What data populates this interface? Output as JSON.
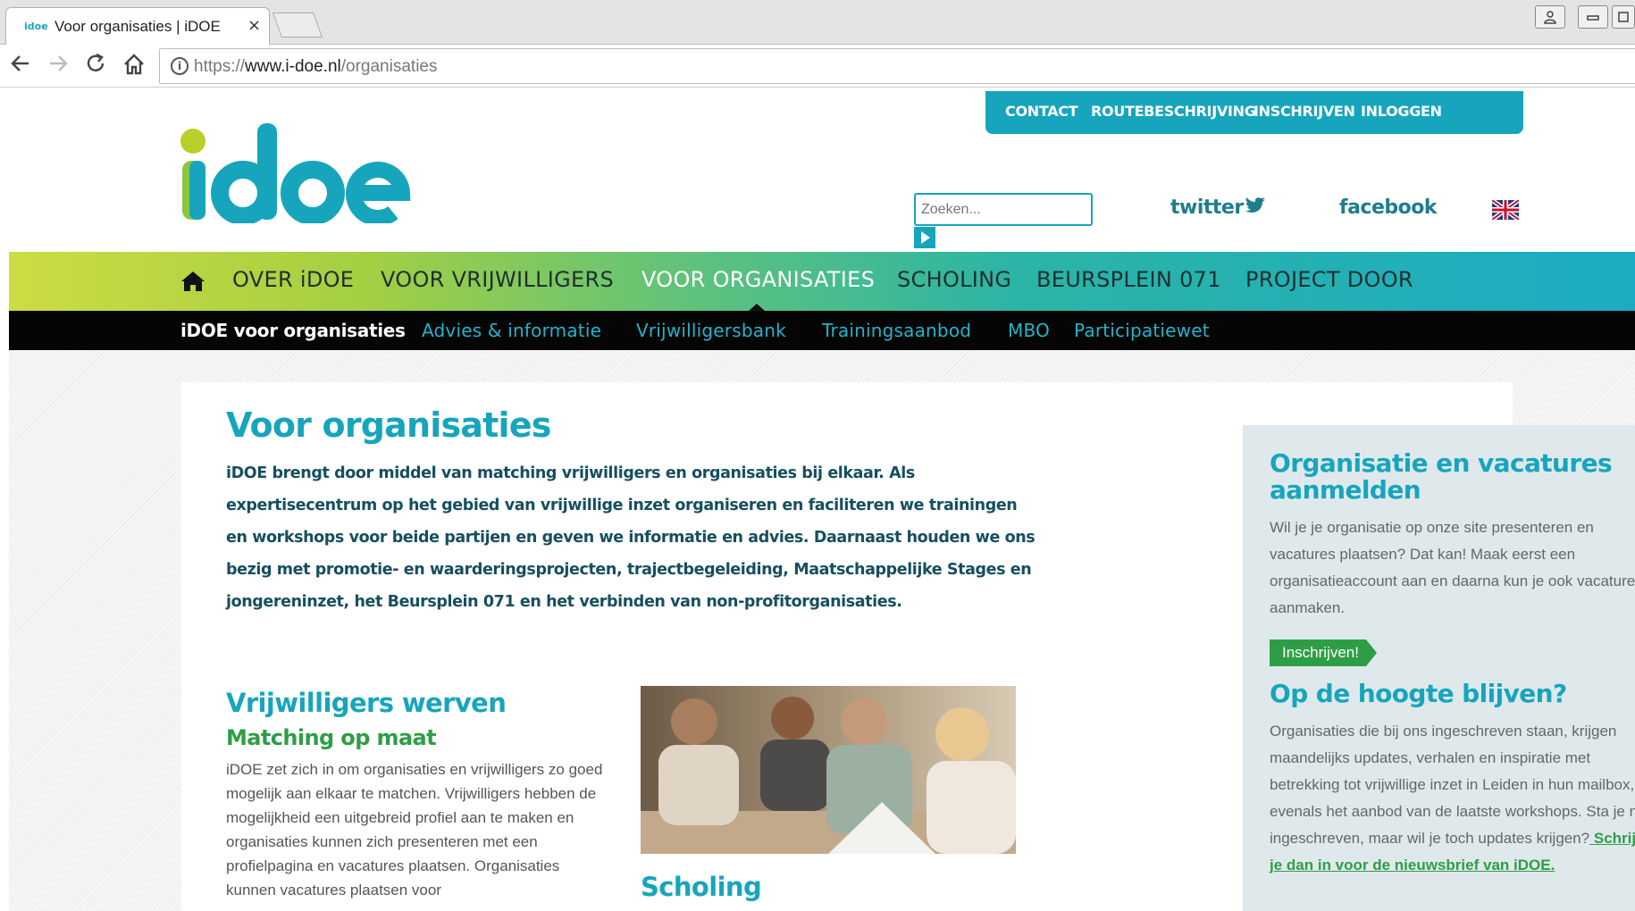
{
  "browser": {
    "tab_title": "Voor organisaties | iDOE",
    "tab_favicon": "idoe",
    "tab_close": "×",
    "url_scheme": "https://",
    "url_host": "www.i-doe.nl",
    "url_path": "/organisaties"
  },
  "header": {
    "top_links": [
      "CONTACT",
      "ROUTEBESCHRIJVING",
      "INSCHRIJVEN",
      "INLOGGEN"
    ],
    "search_placeholder": "Zoeken...",
    "twitter": "twitter",
    "facebook": "facebook",
    "logo": "idoe"
  },
  "main_nav": {
    "items": [
      "OVER iDOE",
      "VOOR VRIJWILLIGERS",
      "VOOR ORGANISATIES",
      "SCHOLING",
      "BEURSPLEIN 071",
      "PROJECT DOOR"
    ],
    "active": "VOOR ORGANISATIES"
  },
  "sub_nav": {
    "items": [
      "iDOE voor organisaties",
      "Advies & informatie",
      "Vrijwilligersbank",
      "Trainingsaanbod",
      "MBO",
      "Participatiewet"
    ]
  },
  "main": {
    "title": "Voor organisaties",
    "intro": "iDOE brengt door middel van matching vrijwilligers en organisaties bij elkaar. Als expertisecentrum op het gebied van vrijwillige inzet organiseren en faciliteren we trainingen en workshops voor beide partijen en geven we informatie en advies. Daarnaast houden we ons bezig met promotie- en waarderingsprojecten, trajectbegeleiding, Maatschappelijke Stages en jongereninzet, het Beursplein 071 en het verbinden van non-profitorganisaties.",
    "section1_title": "Vrijwilligers werven",
    "section1_subtitle": "Matching op maat",
    "section1_text": "iDOE zet zich in om organisaties en vrijwilligers zo goed mogelijk aan elkaar te matchen. Vrijwilligers hebben de mogelijkheid een uitgebreid profiel aan te maken en organisaties kunnen zich presenteren met een profielpagina en vacatures plaatsen. Organisaties kunnen vacatures plaatsen voor",
    "section2_title": "Scholing"
  },
  "sidebar": {
    "block1_title": "Organisatie en vacatures aanmelden",
    "block1_text": "Wil je je organisatie op onze site presenteren en vacatures plaatsen? Dat kan! Maak eerst een organisatieaccount aan en daarna kun je ook vacatures aanmaken.",
    "cta_label": "Inschrijven!",
    "block2_title": "Op de hoogte blijven?",
    "block2_text": "Organisaties die bij ons ingeschreven staan, krijgen maandelijks updates, verhalen en inspiratie met betrekking tot vrijwillige inzet in Leiden in hun mailbox, evenals het aanbod van de laatste workshops. Sta je niet ingeschreven, maar wil je toch updates krijgen?",
    "block2_link": " Schrijf je dan in voor de nieuwsbrief van iDOE."
  },
  "colors": {
    "brand_teal": "#17a5bd",
    "brand_green": "#2e9e45",
    "nav_dark": "#050505"
  }
}
